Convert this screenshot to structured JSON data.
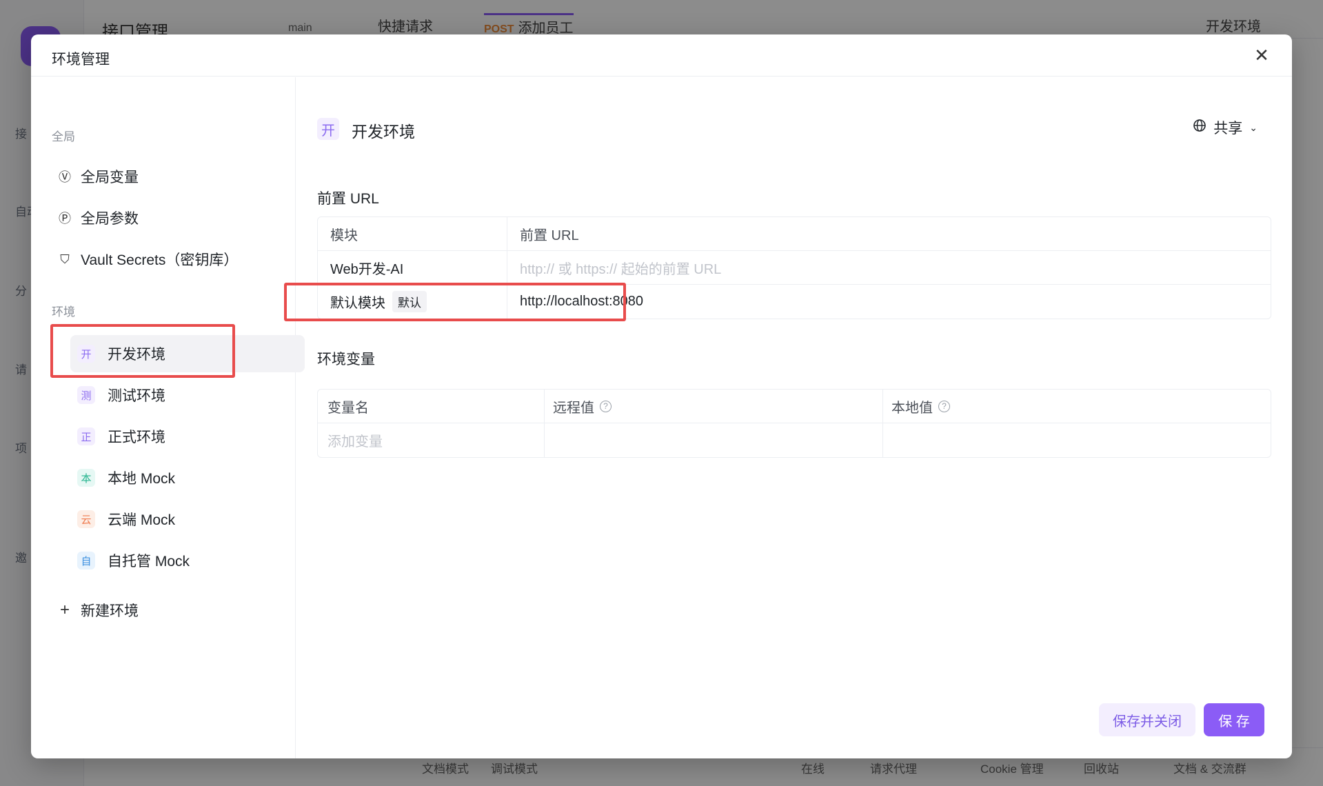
{
  "background": {
    "app_title": "接口管理",
    "branch": "main",
    "tabs": [
      {
        "label": "快捷请求"
      },
      {
        "method": "POST",
        "label": "添加员工"
      }
    ],
    "env_selector": "开发环境",
    "rail_items": [
      "接",
      "自动",
      "分",
      "请",
      "项",
      "邀"
    ],
    "footer_items": [
      "文档模式",
      "调试模式",
      "在线",
      "请求代理",
      "Cookie 管理",
      "回收站",
      "文档 & 交流群"
    ]
  },
  "modal": {
    "title": "环境管理",
    "close_icon": "close-icon",
    "sidebar": {
      "global_label": "全局",
      "global_items": [
        {
          "icon": "variable-icon",
          "glyph": "Ⓥ",
          "label": "全局变量"
        },
        {
          "icon": "parameter-icon",
          "glyph": "Ⓟ",
          "label": "全局参数"
        },
        {
          "icon": "shield-icon",
          "glyph": "⛉",
          "label": "Vault Secrets（密钥库）"
        }
      ],
      "env_label": "环境",
      "environments": [
        {
          "badge": "开",
          "label": "开发环境",
          "color": "#8b6bf0",
          "active": true
        },
        {
          "badge": "测",
          "label": "测试环境",
          "color": "#8b6bf0"
        },
        {
          "badge": "正",
          "label": "正式环境",
          "color": "#8b6bf0"
        },
        {
          "badge": "本",
          "label": "本地 Mock",
          "color": "#25b48e"
        },
        {
          "badge": "云",
          "label": "云端 Mock",
          "color": "#ef7a4e"
        },
        {
          "badge": "自",
          "label": "自托管 Mock",
          "color": "#3b8fe0"
        }
      ],
      "new_env_label": "新建环境"
    },
    "main": {
      "env_badge": "开",
      "env_name": "开发环境",
      "share_label": "共享",
      "prefix_url_title": "前置 URL",
      "url_table": {
        "headers": [
          "模块",
          "前置 URL"
        ],
        "rows": [
          {
            "module": "Web开发-AI",
            "url": "",
            "placeholder": "http:// 或 https:// 起始的前置 URL"
          },
          {
            "module": "默认模块",
            "tag": "默认",
            "url": "http://localhost:8080"
          }
        ]
      },
      "env_vars_title": "环境变量",
      "vars_table": {
        "headers": [
          "变量名",
          "远程值",
          "本地值"
        ],
        "add_placeholder": "添加变量"
      }
    },
    "buttons": {
      "save_close": "保存并关闭",
      "save": "保 存"
    }
  },
  "colors": {
    "accent": "#8b5cf6",
    "highlight": "#e84c4c"
  }
}
